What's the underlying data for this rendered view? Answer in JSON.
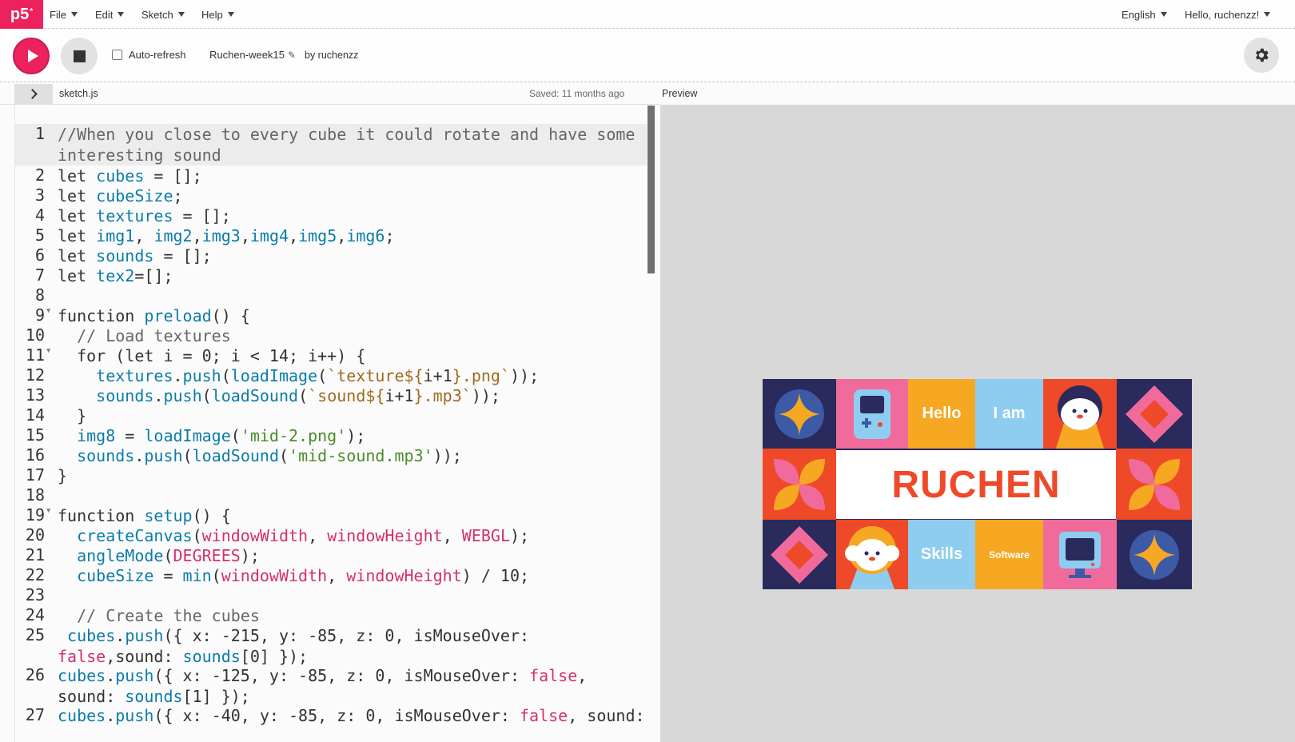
{
  "nav": {
    "logo": "p5",
    "logo_sup": "*",
    "menu": [
      "File",
      "Edit",
      "Sketch",
      "Help"
    ],
    "language": "English",
    "greeting": "Hello, ruchenzz!"
  },
  "toolbar": {
    "auto_refresh_label": "Auto-refresh",
    "auto_refresh_checked": false,
    "sketch_name": "Ruchen-week15",
    "by_user": "by ruchenzz"
  },
  "editor": {
    "filename": "sketch.js",
    "saved_status": "Saved: 11 months ago",
    "preview_label": "Preview",
    "lines": [
      {
        "n": "1",
        "text": "//When you close to every cube it could rotate and have some interesting sound"
      },
      {
        "n": "2",
        "text": "let cubes = [];"
      },
      {
        "n": "3",
        "text": "let cubeSize;"
      },
      {
        "n": "4",
        "text": "let textures = [];"
      },
      {
        "n": "5",
        "text": "let img1, img2,img3,img4,img5,img6;"
      },
      {
        "n": "6",
        "text": "let sounds = [];"
      },
      {
        "n": "7",
        "text": "let tex2=[];"
      },
      {
        "n": "8",
        "text": ""
      },
      {
        "n": "9",
        "text": "function preload() {"
      },
      {
        "n": "10",
        "text": "  // Load textures"
      },
      {
        "n": "11",
        "text": "  for (let i = 0; i < 14; i++) {"
      },
      {
        "n": "12",
        "text": "    textures.push(loadImage(`texture${i+1}.png`));"
      },
      {
        "n": "13",
        "text": "    sounds.push(loadSound(`sound${i+1}.mp3`));"
      },
      {
        "n": "14",
        "text": "  }"
      },
      {
        "n": "15",
        "text": "  img8 = loadImage('mid-2.png');"
      },
      {
        "n": "16",
        "text": "  sounds.push(loadSound('mid-sound.mp3'));"
      },
      {
        "n": "17",
        "text": "}"
      },
      {
        "n": "18",
        "text": ""
      },
      {
        "n": "19",
        "text": "function setup() {"
      },
      {
        "n": "20",
        "text": "  createCanvas(windowWidth, windowHeight, WEBGL);"
      },
      {
        "n": "21",
        "text": "  angleMode(DEGREES);"
      },
      {
        "n": "22",
        "text": "  cubeSize = min(windowWidth, windowHeight) / 10;"
      },
      {
        "n": "23",
        "text": ""
      },
      {
        "n": "24",
        "text": "  // Create the cubes"
      },
      {
        "n": "25",
        "text": " cubes.push({ x: -215, y: -85, z: 0, isMouseOver: false,sound: sounds[0] });"
      },
      {
        "n": "26",
        "text": "cubes.push({ x: -125, y: -85, z: 0, isMouseOver: false, sound: sounds[1] });"
      },
      {
        "n": "27",
        "text": "cubes.push({ x: -40, y: -85, z: 0, isMouseOver: false, sound:"
      }
    ]
  },
  "preview": {
    "banner_text": "RUCHEN",
    "tiles": [
      "Hello",
      "I am",
      "Skills",
      "Software"
    ],
    "colors": {
      "navy": "#2a2a5c",
      "orange": "#ee4a2a",
      "yellow": "#f6a823",
      "pink": "#f06b9b",
      "lightblue": "#8ecdf0",
      "blue": "#3c5aa6"
    }
  }
}
